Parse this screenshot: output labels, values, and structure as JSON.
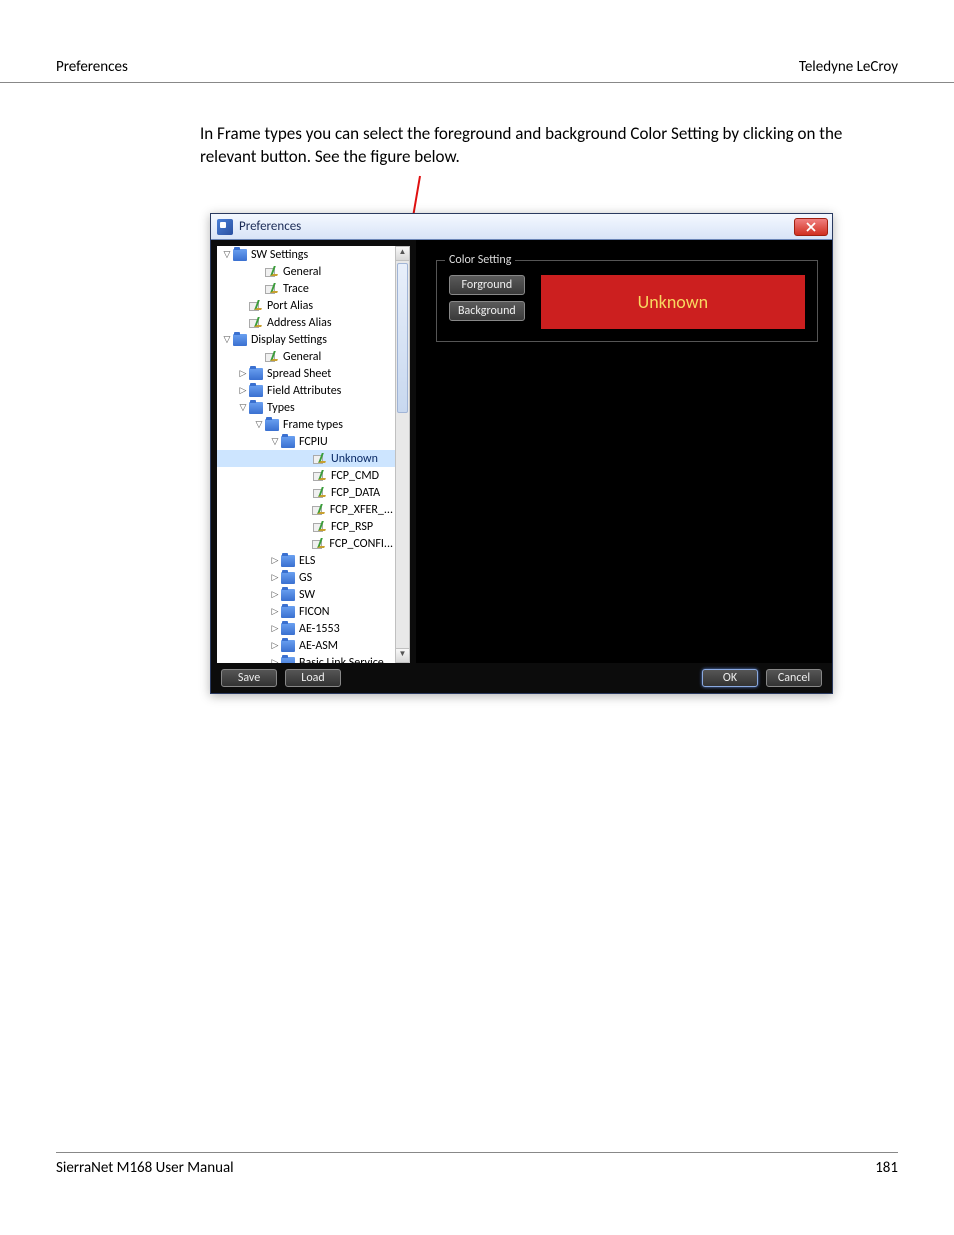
{
  "header": {
    "left": "Preferences",
    "right": "Teledyne LeCroy"
  },
  "body_text": "In Frame types you can select the foreground and background Color Setting by clicking on the relevant button. See the figure below.",
  "dialog": {
    "title": "Preferences",
    "tree": {
      "sw_settings": {
        "label": "SW Settings",
        "general": "General",
        "trace": "Trace"
      },
      "port_alias": "Port Alias",
      "address_alias": "Address Alias",
      "display_settings": {
        "label": "Display Settings",
        "general": "General",
        "spread_sheet": "Spread Sheet",
        "field_attributes": "Field Attributes",
        "types": {
          "label": "Types",
          "frame_types": {
            "label": "Frame types",
            "fcpiu": {
              "label": "FCPIU",
              "unknown": "Unknown",
              "fcp_cmd": "FCP_CMD",
              "fcp_data": "FCP_DATA",
              "fcp_xfer": "FCP_XFER_...",
              "fcp_rsp": "FCP_RSP",
              "fcp_confi": "FCP_CONFI..."
            },
            "els": "ELS",
            "gs": "GS",
            "sw": "SW",
            "ficon": "FICON",
            "ae1553": "AE-1553",
            "aeasm": "AE-ASM",
            "bls": "Basic Link Service"
          }
        }
      }
    },
    "color_setting": {
      "legend": "Color Setting",
      "foreground_btn": "Forground",
      "background_btn": "Background",
      "swatch_label": "Unknown"
    },
    "buttons": {
      "save": "Save",
      "load": "Load",
      "ok": "OK",
      "cancel": "Cancel"
    }
  },
  "footer": {
    "left": "SierraNet M168 User Manual",
    "right": "181"
  }
}
